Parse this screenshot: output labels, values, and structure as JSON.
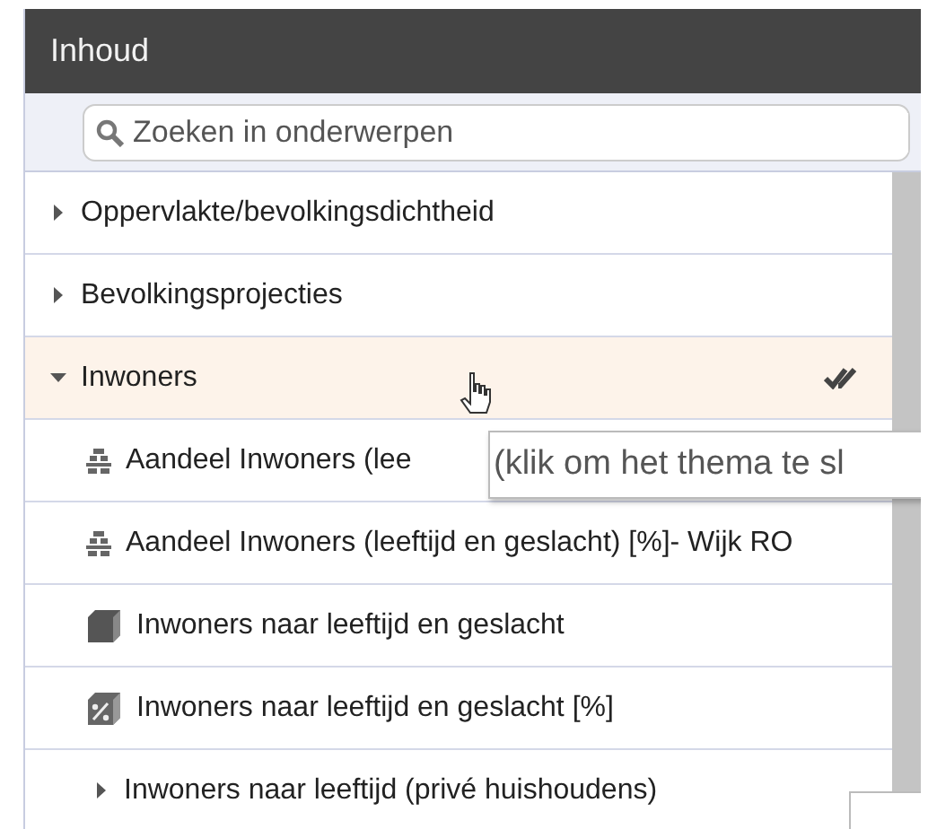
{
  "panel": {
    "title": "Inhoud"
  },
  "search": {
    "placeholder": "Zoeken in onderwerpen"
  },
  "topics": [
    {
      "label": "Oppervlakte/bevolkingsdichtheid",
      "kind": "group",
      "expanded": false,
      "selected": false
    },
    {
      "label": "Bevolkingsprojecties",
      "kind": "group",
      "expanded": false,
      "selected": false
    },
    {
      "label": "Inwoners",
      "kind": "group",
      "expanded": true,
      "selected": true,
      "all_checked": true,
      "children": [
        {
          "label": "Aandeel Inwoners (lee",
          "kind": "map"
        },
        {
          "label": "Aandeel Inwoners (leeftijd en geslacht) [%]- Wijk RO",
          "kind": "map"
        },
        {
          "label": "Inwoners naar leeftijd en geslacht",
          "kind": "cube"
        },
        {
          "label": "Inwoners naar leeftijd en geslacht [%]",
          "kind": "cube-percent"
        },
        {
          "label": "Inwoners naar leeftijd (privé huishoudens)",
          "kind": "group",
          "expanded": false
        }
      ]
    }
  ],
  "tooltip": {
    "text": "(klik om het thema te sl"
  }
}
